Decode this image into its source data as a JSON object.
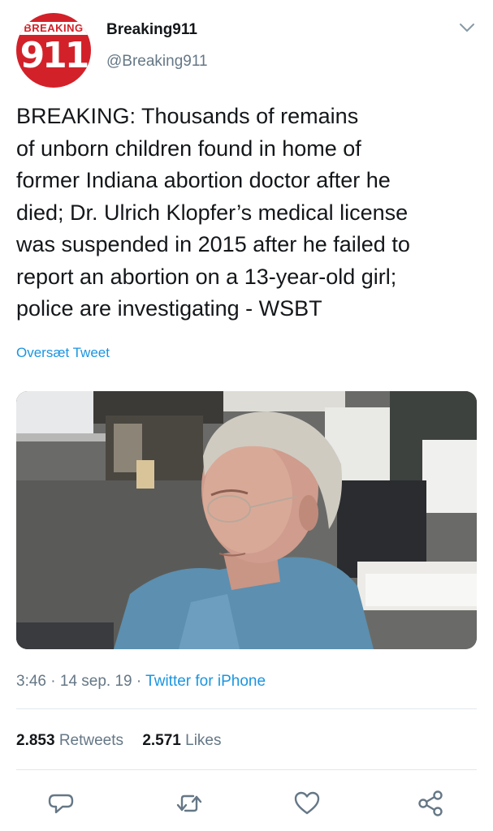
{
  "author": {
    "avatar": {
      "word": "BREAKING",
      "number": "911",
      "color": "#d32129"
    },
    "display_name": "Breaking911",
    "handle": "@Breaking911"
  },
  "tweet": {
    "text": "BREAKING: Thousands of remains\nof unborn children found in home of\nformer Indiana abortion doctor after he\ndied; Dr. Ulrich Klopfer’s medical license\nwas suspended in 2015 after he failed to\nreport an abortion on a 13-year-old girl;\npolice are investigating - WSBT",
    "translate_label": "Oversæt Tweet",
    "media_icon": "photo-of-elderly-man"
  },
  "meta": {
    "time": "3:46",
    "date": "14 sep. 19",
    "separator": " · ",
    "source": "Twitter for iPhone"
  },
  "stats": {
    "retweets_count": "2.853",
    "retweets_label": "Retweets",
    "likes_count": "2.571",
    "likes_label": "Likes"
  },
  "actions": {
    "reply_icon": "reply-icon",
    "retweet_icon": "retweet-icon",
    "like_icon": "heart-icon",
    "share_icon": "share-icon"
  },
  "colors": {
    "link": "#1b95e0",
    "secondary_text": "#657786",
    "divider": "#e1e8ed",
    "icon": "#657786"
  }
}
